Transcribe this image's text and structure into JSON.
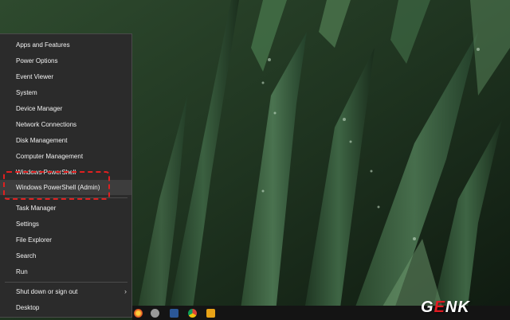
{
  "menu": {
    "items": [
      {
        "label": "Apps and Features"
      },
      {
        "label": "Power Options"
      },
      {
        "label": "Event Viewer"
      },
      {
        "label": "System"
      },
      {
        "label": "Device Manager"
      },
      {
        "label": "Network Connections"
      },
      {
        "label": "Disk Management"
      },
      {
        "label": "Computer Management"
      },
      {
        "label": "Windows PowerShell"
      },
      {
        "label": "Windows PowerShell (Admin)"
      },
      {
        "label": "Task Manager"
      },
      {
        "label": "Settings"
      },
      {
        "label": "File Explorer"
      },
      {
        "label": "Search"
      },
      {
        "label": "Run"
      },
      {
        "label": "Shut down or sign out"
      },
      {
        "label": "Desktop"
      }
    ],
    "submenu_arrow": "›"
  },
  "logo": {
    "g": "G",
    "e": "E",
    "nk": "NK"
  },
  "colors": {
    "menu_bg": "#2b2b2b",
    "highlight": "#3d3d3d",
    "annotation": "#e02020"
  }
}
